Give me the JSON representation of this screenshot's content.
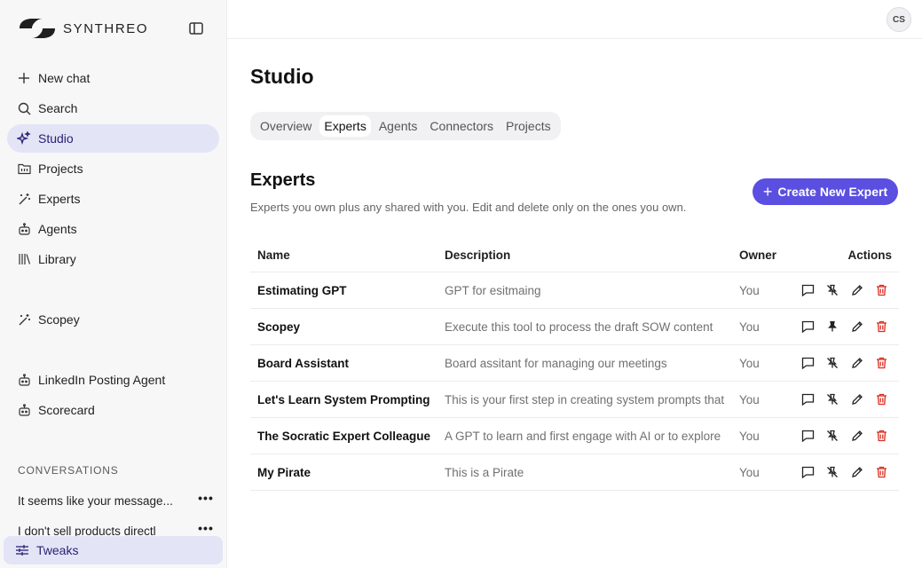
{
  "brand": {
    "name": "SYNTHREO"
  },
  "sidebar": {
    "nav": [
      {
        "label": "New chat",
        "icon": "plus-icon"
      },
      {
        "label": "Search",
        "icon": "search-icon"
      },
      {
        "label": "Studio",
        "icon": "sparkle-icon",
        "active": true
      },
      {
        "label": "Projects",
        "icon": "folder-icon"
      },
      {
        "label": "Experts",
        "icon": "wand-icon"
      },
      {
        "label": "Agents",
        "icon": "robot-icon"
      },
      {
        "label": "Library",
        "icon": "library-icon"
      }
    ],
    "pinned": [
      {
        "label": "Scopey",
        "icon": "wand-icon"
      },
      {
        "label": "LinkedIn Posting Agent",
        "icon": "robot-icon"
      },
      {
        "label": "Scorecard",
        "icon": "robot-icon"
      }
    ],
    "conversations_label": "CONVERSATIONS",
    "conversations": [
      {
        "label": "It seems like your message..."
      },
      {
        "label": "I don't sell products directl"
      }
    ],
    "tweaks_label": "Tweaks"
  },
  "topbar": {
    "avatar_initials": "CS"
  },
  "main": {
    "title": "Studio",
    "tabs": [
      {
        "label": "Overview"
      },
      {
        "label": "Experts",
        "active": true
      },
      {
        "label": "Agents"
      },
      {
        "label": "Connectors"
      },
      {
        "label": "Projects"
      }
    ],
    "section": {
      "title": "Experts",
      "subtitle": "Experts you own plus any shared with you. Edit and delete only on the ones you own.",
      "create_label": "Create New Expert"
    },
    "table": {
      "columns": {
        "name": "Name",
        "description": "Description",
        "owner": "Owner",
        "actions": "Actions"
      },
      "rows": [
        {
          "name": "Estimating GPT",
          "description": "GPT for esitmaing",
          "owner": "You",
          "pinned": false
        },
        {
          "name": "Scopey",
          "description": "Execute this tool to process the draft SOW content",
          "owner": "You",
          "pinned": true
        },
        {
          "name": "Board Assistant",
          "description": "Board assitant for managing our meetings",
          "owner": "You",
          "pinned": false
        },
        {
          "name": "Let's Learn System Prompting",
          "description": "This is your first step in creating system prompts that",
          "owner": "You",
          "pinned": false
        },
        {
          "name": "The Socratic Expert Colleague",
          "description": "A GPT to learn and first engage with AI or to explore",
          "owner": "You",
          "pinned": false
        },
        {
          "name": "My Pirate",
          "description": "This is a Pirate",
          "owner": "You",
          "pinned": false
        }
      ]
    }
  },
  "colors": {
    "accent": "#5a4fe0",
    "active_bg": "#e4e4f7",
    "active_text": "#2a2275",
    "delete": "#d92d20"
  }
}
